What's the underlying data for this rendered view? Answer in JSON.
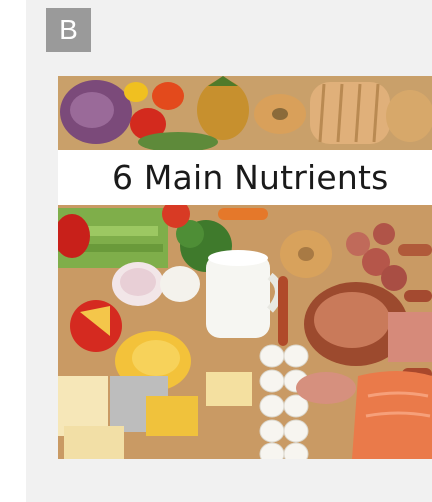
{
  "section_label": "B",
  "figure": {
    "title": "6 Main Nutrients",
    "image_subject": "assorted foods: vegetables, fruits, breads, dairy, eggs, meats and fish"
  }
}
